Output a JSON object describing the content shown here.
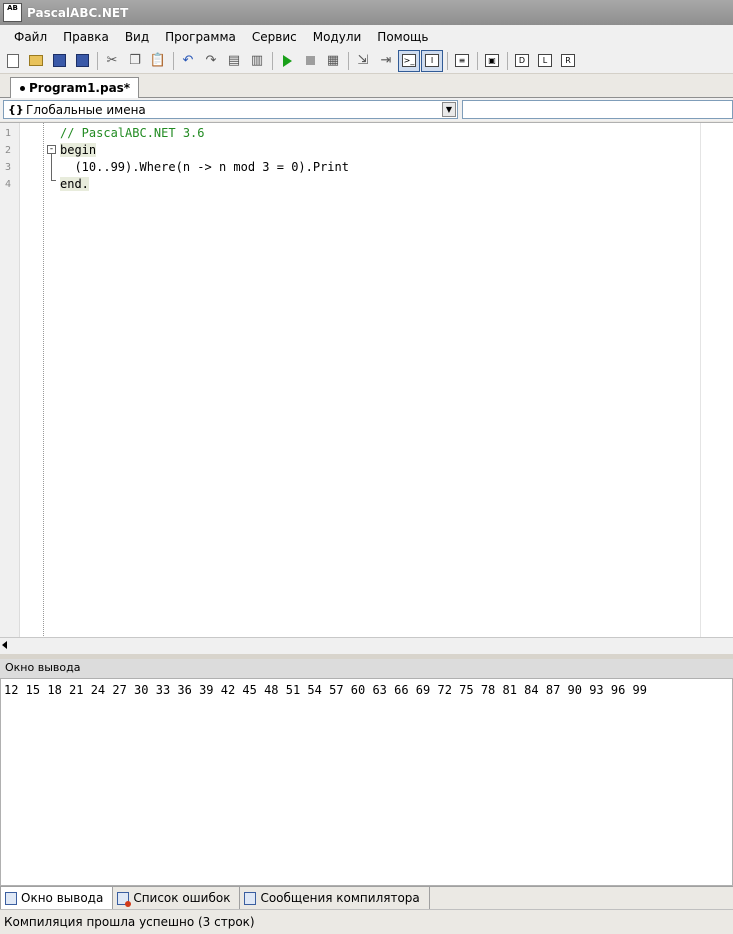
{
  "window": {
    "title": "PascalABC.NET",
    "icon_text": "AB"
  },
  "menu": [
    "Файл",
    "Правка",
    "Вид",
    "Программа",
    "Сервис",
    "Модули",
    "Помощь"
  ],
  "editor_tab": {
    "label": "Program1.pas*"
  },
  "names_combo": {
    "value": "Глобальные имена",
    "icon_text": "{}"
  },
  "editor": {
    "line_numbers": [
      "1",
      "2",
      "3",
      "4"
    ],
    "lines": [
      "// PascalABC.NET 3.6",
      "begin",
      "  (10..99).Where(n -> n mod 3 = 0).Print",
      "end."
    ]
  },
  "output": {
    "header": "Окно вывода",
    "text": "12 15 18 21 24 27 30 33 36 39 42 45 48 51 54 57 60 63 66 69 72 75 78 81 84 87 90 93 96 99"
  },
  "bottom_tabs": [
    "Окно вывода",
    "Список ошибок",
    "Сообщения компилятора"
  ],
  "status": "Компиляция прошла успешно (3 строк)"
}
